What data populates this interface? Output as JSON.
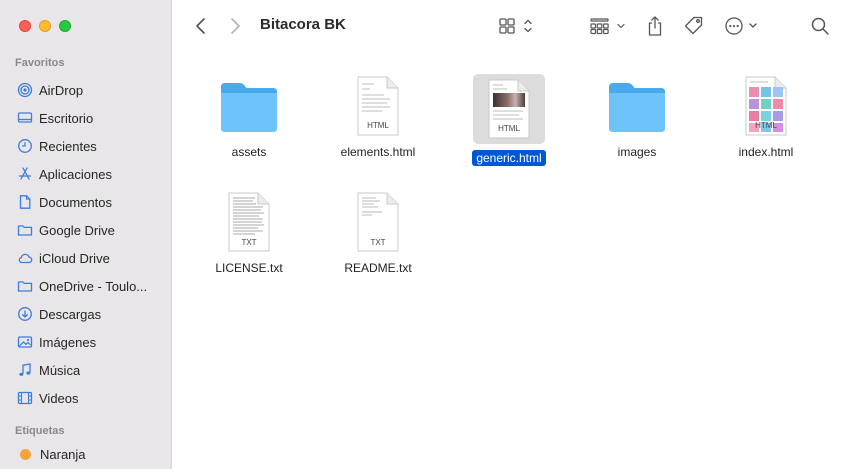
{
  "window": {
    "title": "Bitacora BK"
  },
  "sidebar": {
    "favorites_title": "Favoritos",
    "items": [
      {
        "label": "AirDrop",
        "icon": "airdrop-icon"
      },
      {
        "label": "Escritorio",
        "icon": "desktop-icon"
      },
      {
        "label": "Recientes",
        "icon": "clock-icon"
      },
      {
        "label": "Aplicaciones",
        "icon": "applications-icon"
      },
      {
        "label": "Documentos",
        "icon": "document-icon"
      },
      {
        "label": "Google Drive",
        "icon": "folder-icon"
      },
      {
        "label": "iCloud Drive",
        "icon": "cloud-icon"
      },
      {
        "label": "OneDrive - Toulo...",
        "icon": "folder-icon"
      },
      {
        "label": "Descargas",
        "icon": "download-icon"
      },
      {
        "label": "Imágenes",
        "icon": "photo-icon"
      },
      {
        "label": "Música",
        "icon": "music-note-icon"
      },
      {
        "label": "Videos",
        "icon": "film-icon"
      }
    ],
    "tags_title": "Etiquetas",
    "tags": [
      {
        "label": "Naranja",
        "color": "#f5a33b"
      }
    ]
  },
  "files": [
    {
      "name": "assets",
      "kind": "folder"
    },
    {
      "name": "elements.html",
      "kind": "html",
      "badge": "HTML"
    },
    {
      "name": "generic.html",
      "kind": "html-image",
      "badge": "HTML",
      "selected": true
    },
    {
      "name": "images",
      "kind": "folder"
    },
    {
      "name": "index.html",
      "kind": "html-grid",
      "badge": "HTML"
    },
    {
      "name": "LICENSE.txt",
      "kind": "txt",
      "badge": "TXT"
    },
    {
      "name": "README.txt",
      "kind": "txt",
      "badge": "TXT"
    }
  ],
  "colors": {
    "accent": "#0058d0",
    "sidebar_icon": "#3b7ddd",
    "folder": "#5fb8f5"
  }
}
